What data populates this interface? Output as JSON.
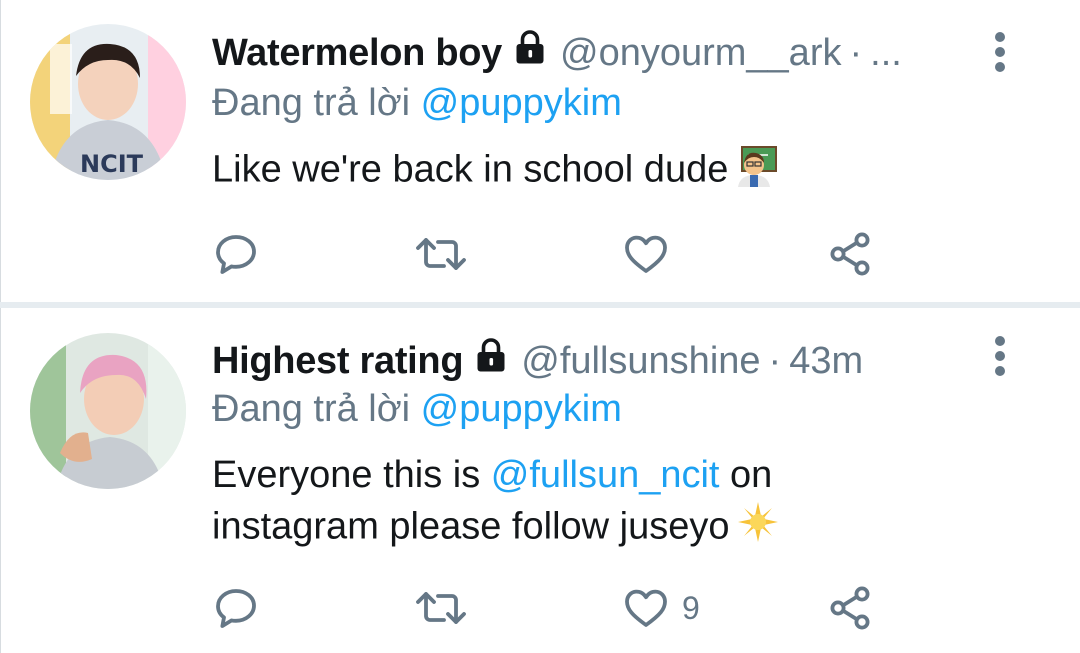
{
  "tweets": [
    {
      "display_name": "Watermelon boy",
      "protected_icon": "lock-icon",
      "handle": "@onyourm__ark",
      "separator": "·",
      "time": "...",
      "reply_prefix": "Đang trả lời",
      "reply_to": "@puppykim",
      "text_parts": [
        "Like we're back in school dude"
      ],
      "mention_in_text": "",
      "text_after_mention": "",
      "emoji": "teacher-emoji",
      "like_count": ""
    },
    {
      "display_name": "Highest rating",
      "protected_icon": "lock-icon",
      "handle": "@fullsunshine",
      "separator": "·",
      "time": "43m",
      "reply_prefix": "Đang trả lời",
      "reply_to": "@puppykim",
      "text_parts": [
        "Everyone this is ",
        " on",
        "instagram please follow juseyo"
      ],
      "mention_in_text": "@fullsun_ncit",
      "emoji": "sun-emoji",
      "like_count": "9"
    }
  ],
  "icons": {
    "reply": "reply-icon",
    "retweet": "retweet-icon",
    "like": "heart-icon",
    "share": "share-icon",
    "more": "more-vertical-icon"
  },
  "colors": {
    "link": "#1da1f2",
    "secondary_text": "#657786",
    "primary_text": "#14171a",
    "divider": "#e6ecf0"
  }
}
